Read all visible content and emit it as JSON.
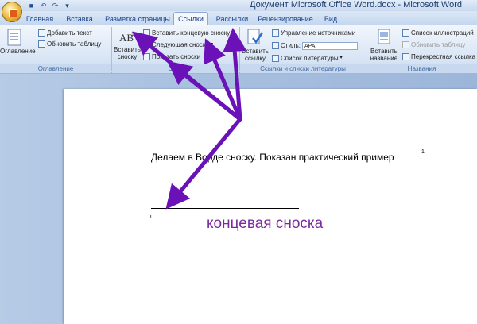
{
  "window": {
    "title": "Документ Microsoft Office Word.docx - Microsoft Word"
  },
  "tabs": [
    "Главная",
    "Вставка",
    "Разметка страницы",
    "Ссылки",
    "Рассылки",
    "Рецензирование",
    "Вид"
  ],
  "active_tab": "Ссылки",
  "ribbon": {
    "toc_group": {
      "big_label": "Оглавление",
      "add_text": "Добавить текст",
      "update_table": "Обновить таблицу",
      "group_label": "Оглавление"
    },
    "footnotes_group": {
      "insert_footnote": "Вставить сноску",
      "insert_endnote": "Вставить концевую сноску",
      "next_footnote": "Следующая сноска",
      "show_notes": "Показать сноски",
      "group_label": "Снос"
    },
    "citations_group": {
      "insert_citation": "Вставить ссылку",
      "manage_sources": "Управление источниками",
      "style_label": "Стиль:",
      "style_value": "APA",
      "bibliography": "Список литературы",
      "group_label": "Ссылки и списки литературы"
    },
    "captions_group": {
      "insert_caption": "Вставить название",
      "table_of_figures": "Список иллюстраций",
      "update_table": "Обновить таблицу",
      "cross_reference": "Перекрестная ссылка",
      "group_label": "Названия"
    }
  },
  "document": {
    "body_text": "Делаем в Ворде сноску. Показан практический  пример",
    "footnote_ref": "1i",
    "note_mark": "i",
    "endnote_text": "концевая сноска"
  },
  "annotation": {
    "arrow_color": "#6a12b8"
  }
}
